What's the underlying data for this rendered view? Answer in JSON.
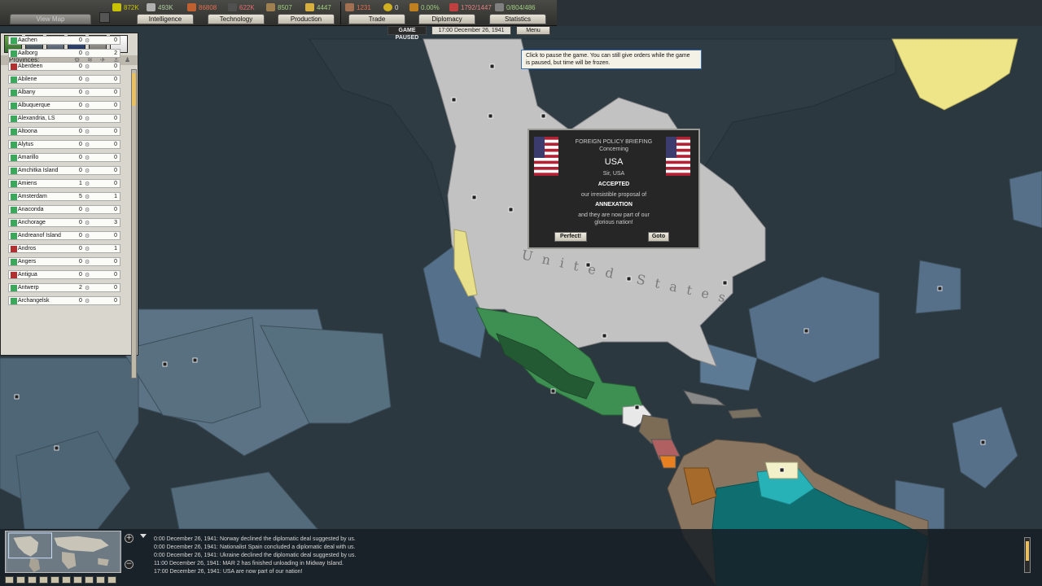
{
  "resources": [
    {
      "name": "energy",
      "value": "872K",
      "color": "#c9c200"
    },
    {
      "name": "metal",
      "value": "493K",
      "color": "#b0b0b0"
    },
    {
      "name": "rare-materials",
      "value": "86808",
      "color": "#c06030"
    },
    {
      "name": "crude-oil",
      "value": "622K",
      "color": "#505050"
    },
    {
      "name": "supplies",
      "value": "8507",
      "color": "#a08050"
    },
    {
      "name": "money",
      "value": "4447",
      "color": "#d8b040"
    },
    {
      "name": "manpower",
      "value": "1231",
      "color": "#a07050"
    },
    {
      "name": "nuclear",
      "value": "0",
      "color": "#d0b020"
    },
    {
      "name": "dissent",
      "value": "0.00%",
      "color": "#c08020"
    },
    {
      "name": "transport",
      "value": "1792/1447",
      "color": "#c04040"
    },
    {
      "name": "escorts",
      "value": "0/804/486",
      "color": "#808080"
    }
  ],
  "tabs": {
    "view_map": "View Map",
    "intelligence": "Intelligence",
    "technology": "Technology",
    "production": "Production",
    "trade": "Trade",
    "diplomacy": "Diplomacy",
    "statistics": "Statistics"
  },
  "status": {
    "paused": "GAME PAUSED",
    "date": "17:00 December 26, 1941",
    "menu": "Menu"
  },
  "panel": {
    "provinces_label": "Provinces:",
    "provinces": [
      {
        "name": "Aachen",
        "a": "0",
        "b": "0",
        "flag": "#3aa85a"
      },
      {
        "name": "Aalborg",
        "a": "0",
        "b": "2",
        "flag": "#3aa85a"
      },
      {
        "name": "Aberdeen",
        "a": "0",
        "b": "0",
        "flag": "#b03030"
      },
      {
        "name": "Abilene",
        "a": "0",
        "b": "0",
        "flag": "#3aa85a"
      },
      {
        "name": "Albany",
        "a": "0",
        "b": "0",
        "flag": "#3aa85a"
      },
      {
        "name": "Albuquerque",
        "a": "0",
        "b": "0",
        "flag": "#3aa85a"
      },
      {
        "name": "Alexandria, LS",
        "a": "0",
        "b": "0",
        "flag": "#3aa85a"
      },
      {
        "name": "Altoona",
        "a": "0",
        "b": "0",
        "flag": "#3aa85a"
      },
      {
        "name": "Alytus",
        "a": "0",
        "b": "0",
        "flag": "#3aa85a"
      },
      {
        "name": "Amarillo",
        "a": "0",
        "b": "0",
        "flag": "#3aa85a"
      },
      {
        "name": "Amchitka Island",
        "a": "0",
        "b": "0",
        "flag": "#3aa85a"
      },
      {
        "name": "Amiens",
        "a": "1",
        "b": "0",
        "flag": "#3aa85a"
      },
      {
        "name": "Amsterdam",
        "a": "5",
        "b": "1",
        "flag": "#3aa85a"
      },
      {
        "name": "Anaconda",
        "a": "0",
        "b": "0",
        "flag": "#3aa85a"
      },
      {
        "name": "Anchorage",
        "a": "0",
        "b": "3",
        "flag": "#3aa85a"
      },
      {
        "name": "Andreanof Island",
        "a": "0",
        "b": "0",
        "flag": "#3aa85a"
      },
      {
        "name": "Andros",
        "a": "0",
        "b": "1",
        "flag": "#b03030"
      },
      {
        "name": "Angers",
        "a": "0",
        "b": "0",
        "flag": "#3aa85a"
      },
      {
        "name": "Antigua",
        "a": "0",
        "b": "0",
        "flag": "#b03030"
      },
      {
        "name": "Antwerp",
        "a": "2",
        "b": "0",
        "flag": "#3aa85a"
      },
      {
        "name": "Archangelsk",
        "a": "0",
        "b": "0",
        "flag": "#3aa85a"
      }
    ]
  },
  "tooltip": {
    "line1": "Click to pause the game. You can still give orders while the game",
    "line2": "is paused, but time will be frozen."
  },
  "popup": {
    "header1": "FOREIGN POLICY BRIEFING",
    "header2": "Concerning",
    "country": "USA",
    "leader": "Sir, USA",
    "accepted": "ACCEPTED",
    "proposal": "our irresistible proposal of",
    "annexation": "ANNEXATION",
    "result1": "and they are now part of our",
    "result2": "glorious nation!",
    "ok_button": "Perfect!",
    "goto_button": "Goto"
  },
  "map_label": "United States",
  "log": [
    "0:00 December 26, 1941: Norway declined the diplomatic deal suggested by us.",
    "0:00 December 26, 1941: Nationalist Spain concluded a diplomatic deal with us.",
    "0:00 December 26, 1941: Ukraine declined the diplomatic deal suggested by us.",
    "11:00 December 26, 1941: MAR 2 has finished unloading in Midway Island.",
    "17:00 December 26, 1941: USA are now part of our nation!"
  ]
}
